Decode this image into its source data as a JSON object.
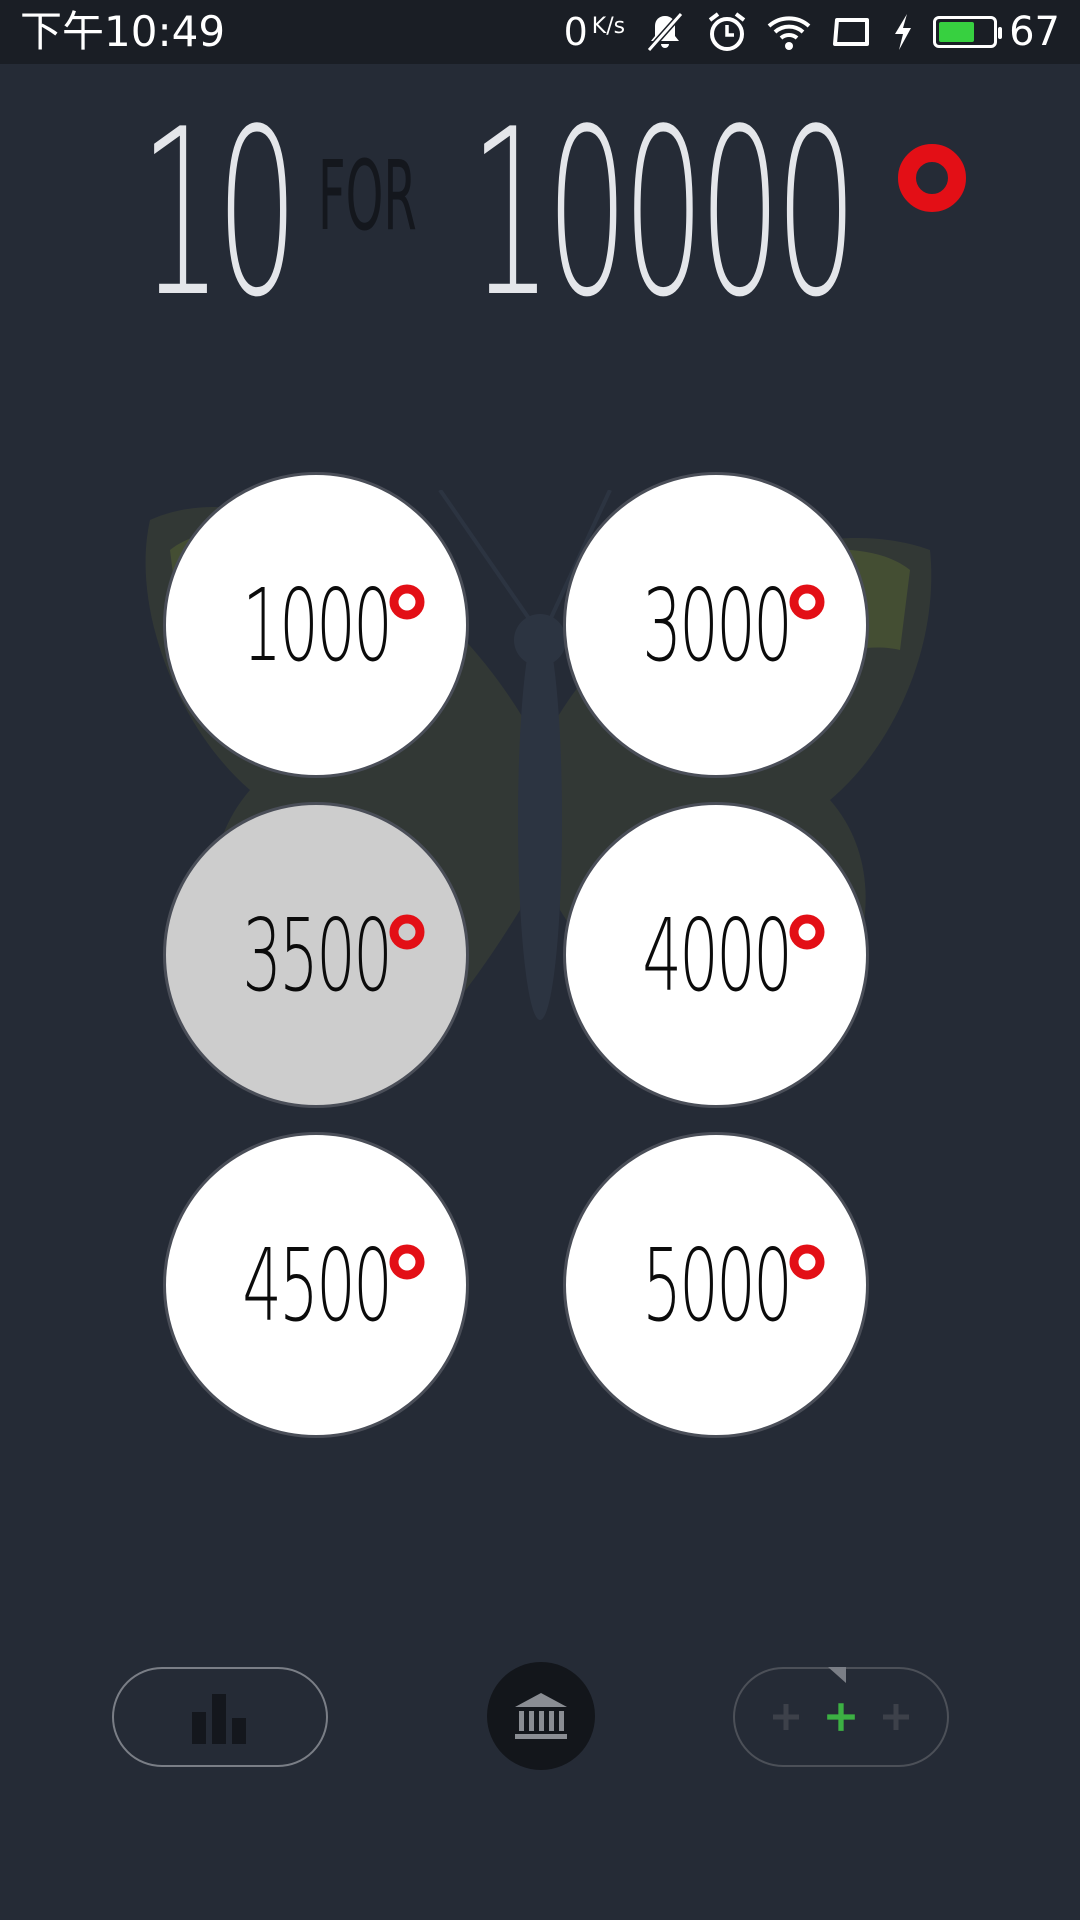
{
  "status_bar": {
    "time": "下午10:49",
    "net_speed_value": "0",
    "net_speed_unit": "K/s",
    "battery_level": "67",
    "battery_fraction": 0.67,
    "icons": [
      "mute-bell-icon",
      "alarm-icon",
      "wifi-icon",
      "screen-rotate-icon",
      "charging-bolt-icon",
      "battery-icon"
    ],
    "battery_color": "#37d040"
  },
  "title": {
    "left_number": "10",
    "connector": "FOR",
    "right_number": "10000",
    "ring_icon": "red-ring-icon",
    "ring_color": "#e30f16"
  },
  "options": [
    {
      "value": "1000",
      "selected": false
    },
    {
      "value": "3000",
      "selected": false
    },
    {
      "value": "3500",
      "selected": true
    },
    {
      "value": "4000",
      "selected": false
    },
    {
      "value": "4500",
      "selected": false
    },
    {
      "value": "5000",
      "selected": false
    }
  ],
  "bottom_nav": {
    "stats_icon": "bar-chart-icon",
    "center_icon": "bank-icon",
    "add_icon": "plus-icons",
    "add_accent_color": "#3cb043"
  },
  "colors": {
    "background": "#252b36",
    "status_bar": "#1a1e25",
    "ring": "#e30f16"
  }
}
